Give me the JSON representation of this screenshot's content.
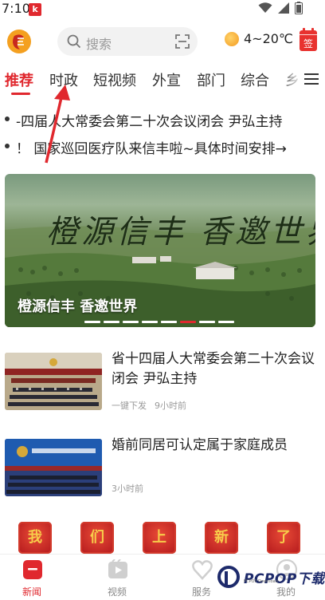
{
  "status_bar": {
    "time": "7:10",
    "app_badge": "k"
  },
  "header": {
    "search_placeholder": "搜索",
    "weather": "4~20℃",
    "checkin_label": "签"
  },
  "tabs": [
    "推荐",
    "时政",
    "短视频",
    "外宣",
    "部门",
    "综合",
    "乡"
  ],
  "ticker": [
    "-四届人大常委会第二十次会议闭会 尹弘主持",
    "！ 国家巡回医疗队来信丰啦~具体时间安排→"
  ],
  "banner": {
    "calligraphy": "橙源信丰 香邀世界",
    "caption": "橙源信丰  香邀世界",
    "slide_count": 8,
    "active_slide": 6
  },
  "news": [
    {
      "title": "省十四届人大常委会第二十次会议闭会 尹弘主持",
      "source": "一键下发",
      "time": "9小时前"
    },
    {
      "title": "婚前同居可认定属于家庭成员",
      "source": "",
      "time": "3小时前"
    }
  ],
  "seals": [
    "我",
    "们",
    "上",
    "新",
    "了"
  ],
  "bottom_nav": [
    {
      "label": "新闻",
      "icon": "news-icon",
      "active": true
    },
    {
      "label": "视频",
      "icon": "video-icon",
      "active": false
    },
    {
      "label": "服务",
      "icon": "service-icon",
      "active": false
    },
    {
      "label": "我的",
      "icon": "profile-icon",
      "active": false
    }
  ],
  "watermark": {
    "brand": "PCPOP下载",
    "sub": "PCPOP Download"
  },
  "colors": {
    "accent": "#e0282e",
    "text": "#222222",
    "muted": "#9a9a9a"
  }
}
